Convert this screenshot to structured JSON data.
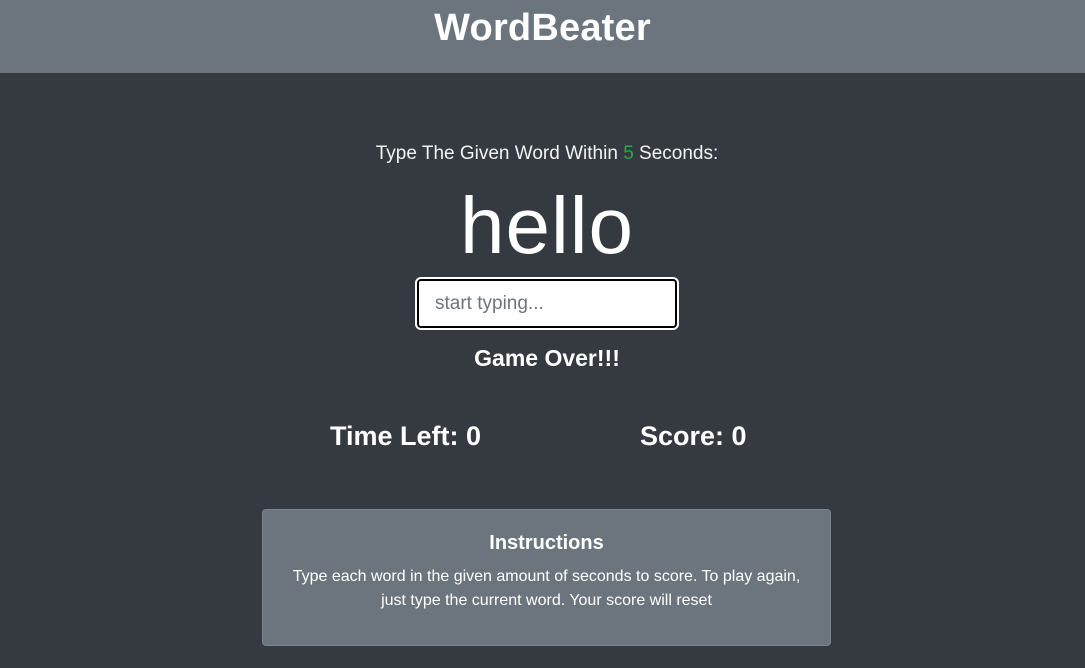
{
  "header": {
    "title": "WordBeater"
  },
  "lead": {
    "prefix": "Type The Given Word Within ",
    "seconds": "5",
    "suffix": " Seconds:"
  },
  "current_word": "hello",
  "input": {
    "value": "",
    "placeholder": "start typing..."
  },
  "message": "Game Over!!!",
  "stats": {
    "time_label": "Time Left: ",
    "time_value": "0",
    "score_label": "Score: ",
    "score_value": "0"
  },
  "instructions": {
    "title": "Instructions",
    "body": "Type each word in the given amount of seconds to score. To play again, just type the current word. Your score will reset"
  },
  "colors": {
    "header_bg": "#6c757d",
    "page_bg": "#343a40",
    "seconds_accent": "#28a745"
  }
}
